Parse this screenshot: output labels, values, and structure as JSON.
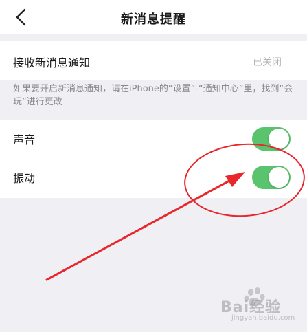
{
  "header": {
    "title": "新消息提醒"
  },
  "notification_row": {
    "label": "接收新消息通知",
    "value": "已关闭"
  },
  "hint_text": "如果要开启新消息通知，请在iPhone的“设置”-“通知中心”里，找到“会玩”进行更改",
  "settings": [
    {
      "label": "声音",
      "enabled": true
    },
    {
      "label": "振动",
      "enabled": true
    }
  ],
  "colors": {
    "toggle_on": "#5ac36d",
    "annotation": "#e8262c"
  },
  "watermark": {
    "brand": "Bai经验",
    "url": "jingyan.baidu.com"
  }
}
